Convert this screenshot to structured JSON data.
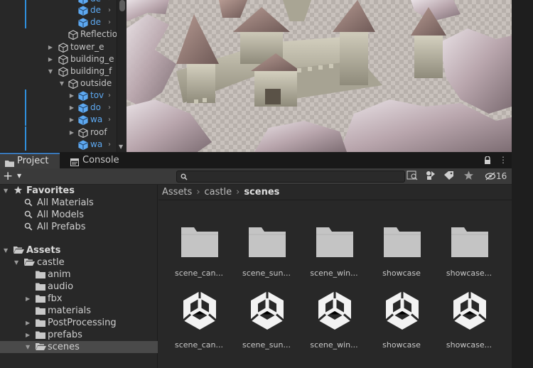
{
  "hierarchy": {
    "items": [
      {
        "label": "de",
        "color": "blue",
        "indent": 3,
        "bar": true,
        "has_chevron": true
      },
      {
        "label": "de",
        "color": "blue",
        "indent": 3,
        "bar": true,
        "has_chevron": true
      },
      {
        "label": "de",
        "color": "blue",
        "indent": 3,
        "bar": true,
        "has_chevron": true
      },
      {
        "label": "Reflectio",
        "color": "grey",
        "indent": 2,
        "bar": false,
        "has_chevron": false
      },
      {
        "label": "tower_e",
        "color": "grey",
        "indent": 1,
        "bar": false,
        "arrow": "right"
      },
      {
        "label": "building_e",
        "color": "grey",
        "indent": 1,
        "bar": false,
        "arrow": "right"
      },
      {
        "label": "building_f",
        "color": "grey",
        "indent": 1,
        "bar": false,
        "arrow": "down"
      },
      {
        "label": "outside",
        "color": "grey",
        "indent": 2,
        "bar": false,
        "arrow": "down"
      },
      {
        "label": "tov",
        "color": "blue",
        "indent": 3,
        "bar": true,
        "arrow": "right",
        "has_chevron": true
      },
      {
        "label": "do",
        "color": "blue",
        "indent": 3,
        "bar": true,
        "arrow": "right",
        "has_chevron": true
      },
      {
        "label": "wa",
        "color": "blue",
        "indent": 3,
        "bar": true,
        "arrow": "right",
        "has_chevron": true
      },
      {
        "label": "roof",
        "color": "grey",
        "indent": 3,
        "bar": true,
        "arrow": "right"
      },
      {
        "label": "wa",
        "color": "blue",
        "indent": 3,
        "bar": true,
        "has_chevron": true
      }
    ]
  },
  "project": {
    "tabs": [
      {
        "label": "Project",
        "icon": "folder-icon",
        "active": true
      },
      {
        "label": "Console",
        "icon": "console-icon",
        "active": false
      }
    ],
    "toolbar": {
      "add_symbol": "+",
      "search_value": "",
      "hidden_count": "16"
    },
    "favorites": {
      "label": "Favorites",
      "items": [
        "All Materials",
        "All Models",
        "All Prefabs"
      ]
    },
    "assets_tree": {
      "root": "Assets",
      "folder": "castle",
      "children": [
        {
          "label": "anim",
          "arrow": false
        },
        {
          "label": "audio",
          "arrow": false
        },
        {
          "label": "fbx",
          "arrow": true
        },
        {
          "label": "materials",
          "arrow": false
        },
        {
          "label": "PostProcessing",
          "arrow": true
        },
        {
          "label": "prefabs",
          "arrow": true
        },
        {
          "label": "scenes",
          "arrow": "down",
          "selected": true
        }
      ]
    },
    "breadcrumb": [
      "Assets",
      "castle",
      "scenes"
    ],
    "folders": [
      "scene_can...",
      "scene_sun...",
      "scene_win...",
      "showcase",
      "showcase..."
    ],
    "scenes": [
      "scene_can...",
      "scene_sun...",
      "scene_win...",
      "showcase",
      "showcase..."
    ]
  },
  "colors": {
    "accent_blue": "#5da8f0",
    "selection": "#4a4a4a",
    "panel": "#282828"
  }
}
